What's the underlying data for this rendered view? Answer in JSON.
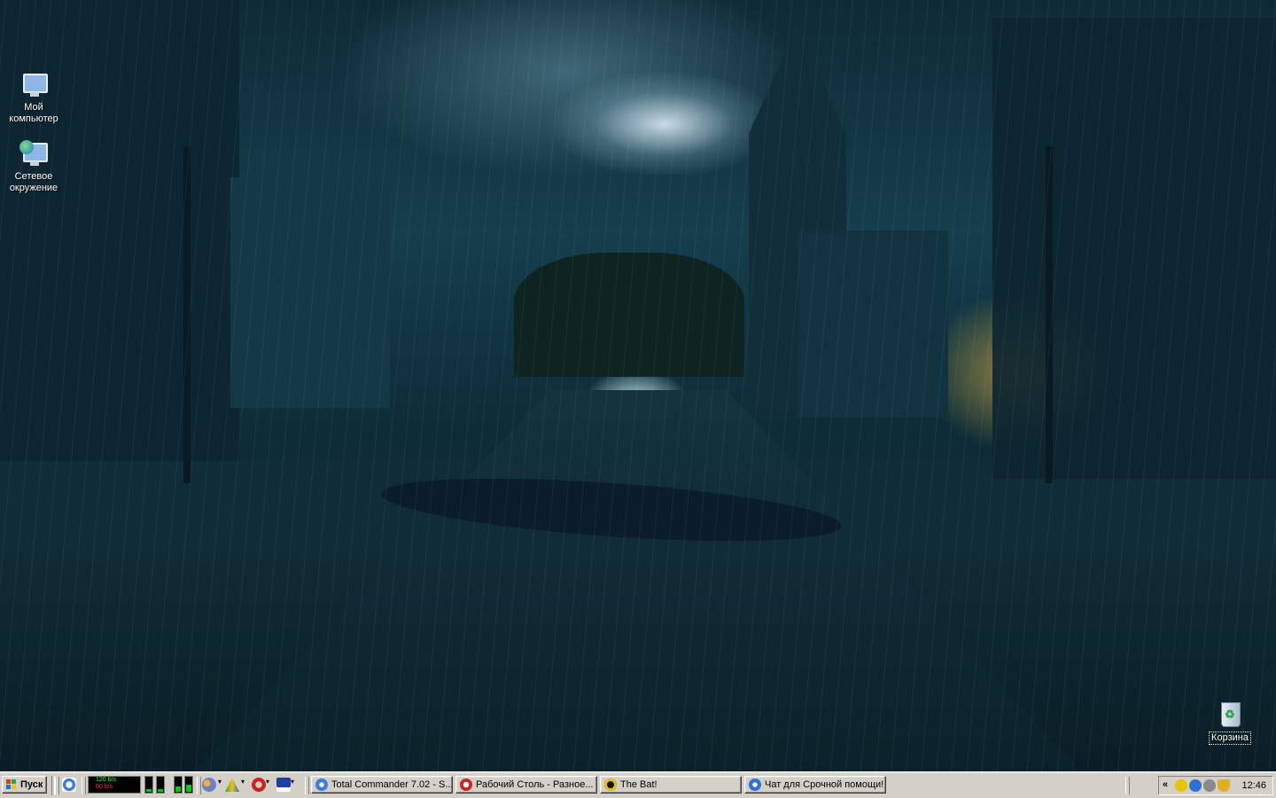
{
  "desktop": {
    "icons": [
      {
        "label": "Мой компьютер",
        "icon": "my-computer-icon"
      },
      {
        "label": "Сетевое окружение",
        "icon": "network-places-icon"
      },
      {
        "label": "Корзина",
        "icon": "recycle-bin-icon"
      }
    ]
  },
  "taskbar": {
    "start_label": "Пуск",
    "netmon": {
      "up": "120 b/s",
      "down": "60 b/s"
    },
    "tasks": [
      {
        "label": "Total Commander 7.02 - S...",
        "icon": "total-commander-icon",
        "color": "#3b7dd8"
      },
      {
        "label": "Рабочий Столь - Разное...",
        "icon": "opera-icon",
        "color": "#cc2222"
      },
      {
        "label": "The Bat!",
        "icon": "the-bat-icon",
        "color": "#e8c400"
      },
      {
        "label": "Чат для Срочной помощи!",
        "icon": "chat-icon",
        "color": "#2a72d6"
      }
    ],
    "tray": {
      "expand_label": "«",
      "icons": [
        "moon-icon",
        "network-icon",
        "sound-icon",
        "shield-icon"
      ],
      "clock": "12:46"
    }
  }
}
